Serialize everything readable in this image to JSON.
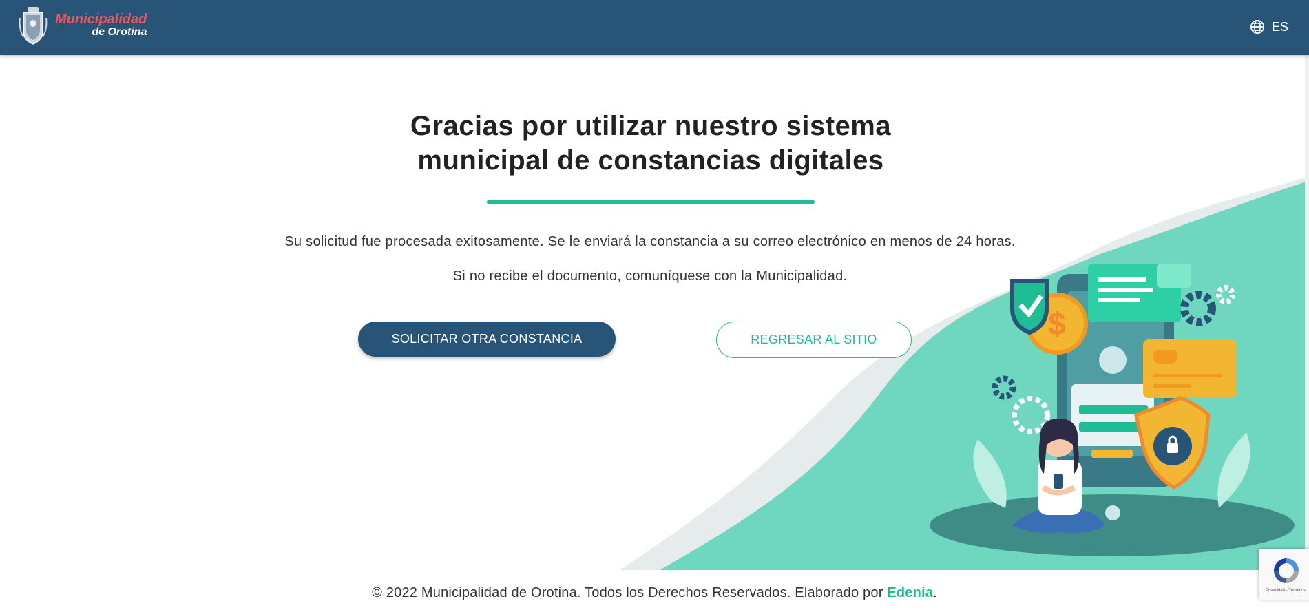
{
  "header": {
    "logo_line1": "Municipalidad",
    "logo_line2": "de Orotina",
    "language": "ES",
    "language_icon": "globe-icon"
  },
  "main": {
    "title_line1": "Gracias por utilizar nuestro sistema",
    "title_line2": "municipal de constancias digitales",
    "message_1": "Su solicitud fue procesada exitosamente. Se le enviará la constancia a su correo electrónico en menos de 24 horas.",
    "message_2": "Si no recibe el documento, comuníquese con la Municipalidad.",
    "primary_button": "SOLICITAR OTRA CONSTANCIA",
    "secondary_button": "REGRESAR AL SITIO"
  },
  "footer": {
    "text": "© 2022 Municipalidad de Orotina. Todos los Derechos Reservados. Elaborado por ",
    "link": "Edenia",
    "end": "."
  },
  "recaptcha": {
    "text": "Privacidad - Términos"
  },
  "colors": {
    "header_bg": "#275477",
    "accent": "#1fbd96",
    "logo_red": "#e8585e",
    "illustration_green": "#6fd6c0"
  }
}
